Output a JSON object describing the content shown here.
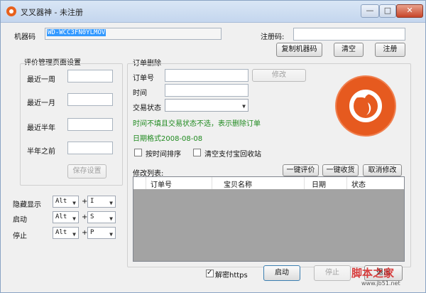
{
  "window": {
    "title": "叉叉器神 - 未注册",
    "controls": {
      "minimize": "—",
      "maximize": "□",
      "close": "✕"
    }
  },
  "machine": {
    "label": "机器码",
    "value": "WD-WCC3FN0YLMOV"
  },
  "register": {
    "label": "注册码:",
    "value": ""
  },
  "buttons": {
    "copy": "复制机器码",
    "clear": "清空",
    "register": "注册"
  },
  "review": {
    "title": "评价管理页面设置",
    "rows": [
      {
        "label": "最近一周",
        "value": ""
      },
      {
        "label": "最近一月",
        "value": ""
      },
      {
        "label": "最近半年",
        "value": ""
      },
      {
        "label": "半年之前",
        "value": ""
      }
    ],
    "save": "保存设置"
  },
  "hotkeys": [
    {
      "label": "隐藏显示",
      "mod": "Alt",
      "plus": "+",
      "key": "I"
    },
    {
      "label": "启动",
      "mod": "Alt",
      "plus": "+",
      "key": "S"
    },
    {
      "label": "停止",
      "mod": "Alt",
      "plus": "+",
      "key": "P"
    }
  ],
  "order": {
    "title": "订单删除",
    "order_no_label": "订单号",
    "time_label": "时间",
    "status_label": "交易状态",
    "modify": "修改",
    "hint1": "时间不填且交易状态不选，表示删除订单",
    "hint2": "日期格式2008-08-08",
    "sort_label": "按时间排序",
    "clear_recycle_label": "清空支付宝回收站",
    "list_label": "修改列表:",
    "one_review": "一键评价",
    "one_receive": "一键收货",
    "cancel_modify": "取消修改",
    "columns": [
      "订单号",
      "宝贝名称",
      "日期",
      "状态"
    ]
  },
  "bottom": {
    "decrypt_label": "解密https",
    "decrypt_checked": true,
    "start": "启动",
    "stop": "停止",
    "exit": "退出"
  },
  "watermark": {
    "text": "脚本之家",
    "url": "www.jb51.net"
  },
  "colors": {
    "accent": "#e65a1f",
    "hint": "#1f8a1f",
    "titlebar": "#c4d6ee"
  },
  "icons": {
    "app": "firefox-logo-icon",
    "logo": "firefox-logo-icon"
  }
}
